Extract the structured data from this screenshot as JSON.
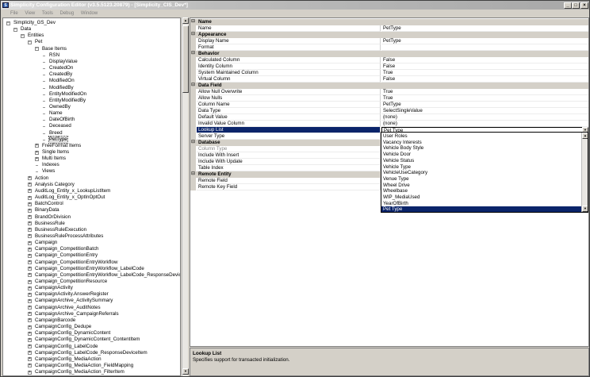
{
  "window": {
    "title": "Simplicity Configuration Editor (v3.5.5123.20879) - [Simplicity_CIS_Dev*]",
    "app_icon": "S"
  },
  "menu": [
    "File",
    "View",
    "Tools",
    "Debug",
    "Window"
  ],
  "tree": {
    "root": "Simplicity_GS_Dev",
    "data": "Data",
    "entities": "Entities",
    "pet": "Pet",
    "base_items": "Base Items",
    "pet_fields": [
      "RSN",
      "DisplayValue",
      "CreatedOn",
      "CreatedBy",
      "ModifiedOn",
      "ModifiedBy",
      "EntityModifiedOn",
      "EntityModifiedBy",
      "OwnedBy",
      "Name",
      "DateOfBirth",
      "Deceased",
      "Breed",
      "PetType"
    ],
    "pet_groups": [
      "FreeFormat Items",
      "Single Items",
      "Multi Items",
      "Indexes",
      "Views"
    ],
    "entities_list": [
      "Action",
      "Analysis Category",
      "AuditLog_Entity_x_LookupListItem",
      "AuditLog_Entity_x_OptInOptOut",
      "BatchControl",
      "BinaryData",
      "BrandOrDivision",
      "BusinessRule",
      "BusinessRuleExecution",
      "BusinessRuleProcessAttributes",
      "Campaign",
      "Campaign_CompetitionBatch",
      "Campaign_CompetitionEntry",
      "Campaign_CompetitionEntryWorkflow",
      "Campaign_CompetitionEntryWorkflow_LabelCode",
      "Campaign_CompetitionEntryWorkflow_LabelCode_ResponseDeviceItem",
      "Campaign_CompetitionResource",
      "CampaignActivity",
      "CampaignActivity.AnswerRegister",
      "CampaignArchive_ActivitySummary",
      "CampaignArchive_AuditNotes",
      "CampaignArchive_CampaignReferrals",
      "CampaignBarcode",
      "CampaignConfig_Dedupe",
      "CampaignConfig_DynamicContent",
      "CampaignConfig_DynamicContent_ContentItem",
      "CampaignConfig_LabelCode",
      "CampaignConfig_LabelCode_ResponseDeviceItem",
      "CampaignConfig_MediaAction",
      "CampaignConfig_MediaAction_FieldMapping",
      "CampaignConfig_MediaAction_FilterItem",
      "CampaignConfig_MediaAction_RelationshipMapping"
    ]
  },
  "grid": {
    "rows": [
      {
        "type": "cat",
        "name": "Name"
      },
      {
        "type": "prop",
        "name": "Name",
        "value": "PetType"
      },
      {
        "type": "cat",
        "name": "Appearance"
      },
      {
        "type": "prop",
        "name": "Display Name",
        "value": "PetType"
      },
      {
        "type": "prop",
        "name": "Format",
        "value": ""
      },
      {
        "type": "cat",
        "name": "Behavior"
      },
      {
        "type": "prop",
        "name": "Calculated Column",
        "value": "False"
      },
      {
        "type": "prop",
        "name": "Identity Column",
        "value": "False"
      },
      {
        "type": "prop",
        "name": "System Maintained Column",
        "value": "True"
      },
      {
        "type": "prop",
        "name": "Virtual Column",
        "value": "False"
      },
      {
        "type": "cat",
        "name": "Data Field"
      },
      {
        "type": "prop",
        "name": "Allow Null Overwrite",
        "value": "True"
      },
      {
        "type": "prop",
        "name": "Allow Nulls",
        "value": "True"
      },
      {
        "type": "prop",
        "name": "Column Name",
        "value": "PetType"
      },
      {
        "type": "prop",
        "name": "Data Type",
        "value": "SelectSingleValue"
      },
      {
        "type": "prop",
        "name": "Default Value",
        "value": "(none)"
      },
      {
        "type": "prop",
        "name": "Invalid Value Column",
        "value": "(none)"
      },
      {
        "type": "sel",
        "name": "Lookup List",
        "value": "Pet Type"
      },
      {
        "type": "prop",
        "name": "Server Type",
        "value": ""
      },
      {
        "type": "cat",
        "name": "Database"
      },
      {
        "type": "grey",
        "name": "Column Type",
        "value": ""
      },
      {
        "type": "prop",
        "name": "Include With Insert",
        "value": ""
      },
      {
        "type": "prop",
        "name": "Include With Update",
        "value": ""
      },
      {
        "type": "prop",
        "name": "Table Index",
        "value": ""
      },
      {
        "type": "cat",
        "name": "Remote Entity"
      },
      {
        "type": "prop",
        "name": "Remote Field",
        "value": ""
      },
      {
        "type": "prop",
        "name": "Remote Key Field",
        "value": ""
      }
    ]
  },
  "dropdown": {
    "items": [
      "User Roles",
      "Vacancy Interests",
      "Vehicle Body Style",
      "Vehicle Door",
      "Vehicle Status",
      "Vehicle Type",
      "VehicleUseCategory",
      "Venue Type",
      "Wheel Drive",
      "Wheelbase",
      "WIP_MediaUsed",
      "YearOfBirth",
      "Pet Type"
    ],
    "selected": "Pet Type"
  },
  "help": {
    "title": "Lookup List",
    "description": "Specifies support for transacted initialization."
  }
}
